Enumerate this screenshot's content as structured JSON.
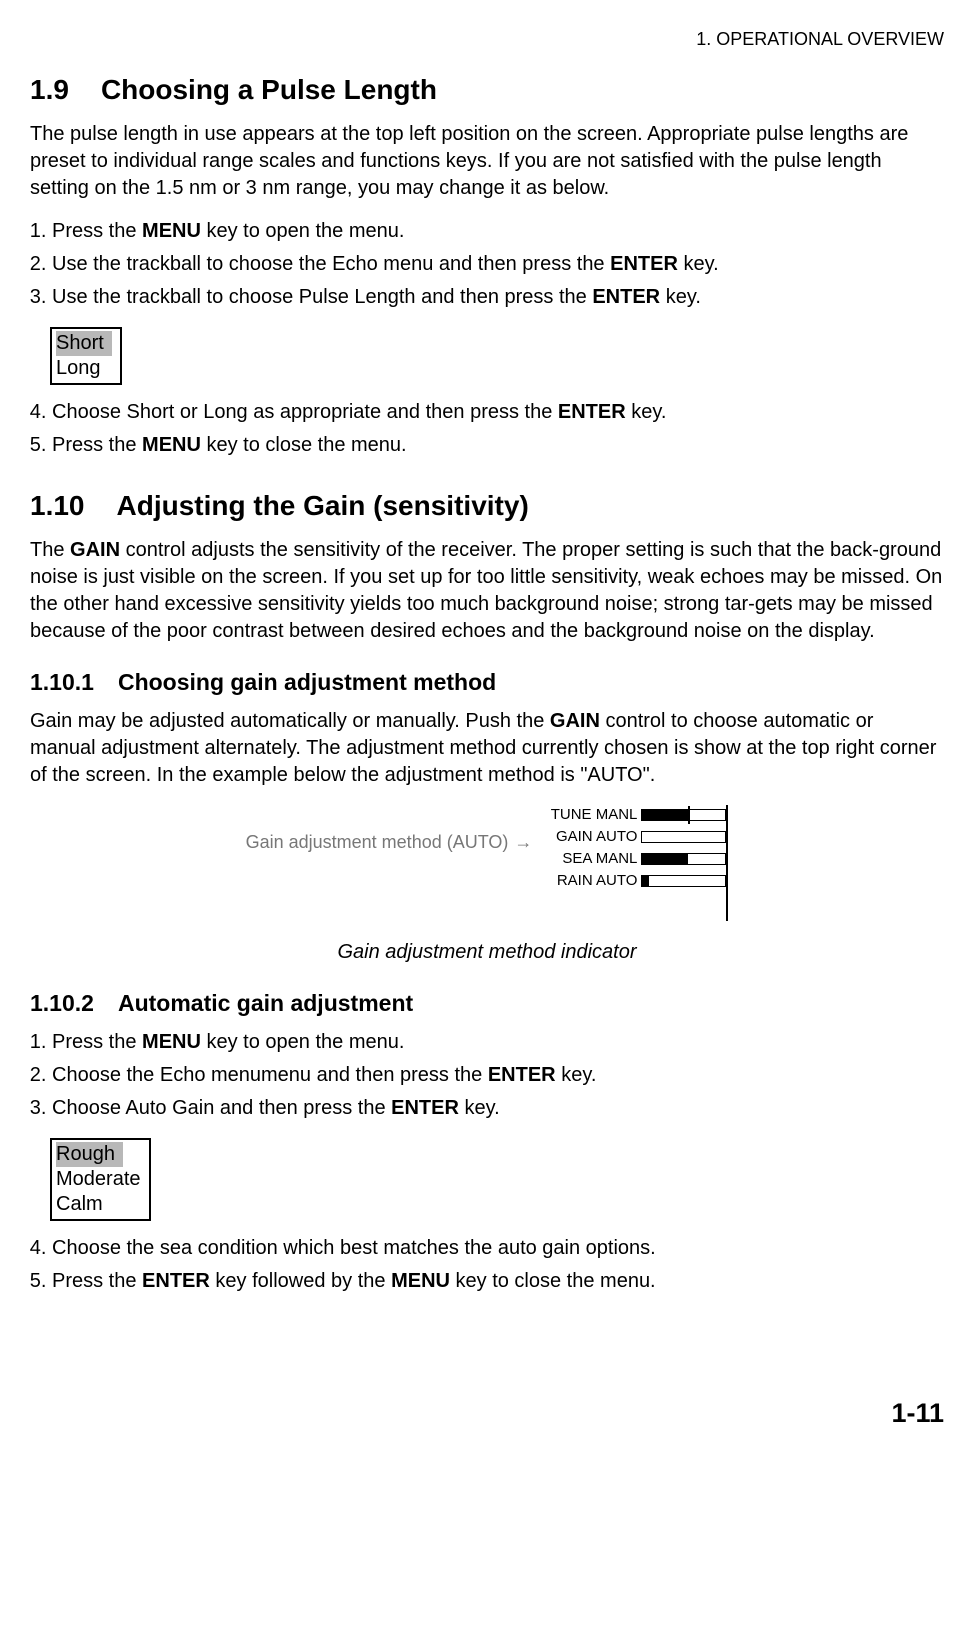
{
  "header": "1. OPERATIONAL OVERVIEW",
  "sec19": {
    "num": "1.9",
    "title": "Choosing a Pulse Length",
    "intro": "The pulse length in use appears at the top left position on the screen. Appropriate pulse lengths are preset to individual range scales and functions keys. If you are not satisfied with the pulse length setting on the 1.5 nm or 3 nm range, you may change it as below.",
    "step1a": "Press the ",
    "step1b": "MENU",
    "step1c": " key to open the menu.",
    "step2a": "Use the trackball to choose the Echo menu and then press the ",
    "step2b": "ENTER",
    "step2c": " key.",
    "step3a": "Use the trackball to choose Pulse Length and then press the ",
    "step3b": "ENTER",
    "step3c": " key.",
    "opt_short": "Short",
    "opt_long": "Long",
    "step4a": "Choose Short or Long as appropriate and then press the ",
    "step4b": "ENTER",
    "step4c": " key.",
    "step5a": "Press the ",
    "step5b": "MENU",
    "step5c": " key to close the menu."
  },
  "sec110": {
    "num": "1.10",
    "title": "Adjusting the Gain (sensitivity)",
    "intro_a": "The ",
    "intro_b": "GAIN",
    "intro_c": " control adjusts the sensitivity of the receiver. The proper setting is such that the back-ground noise is just visible on the screen. If you set up for too little sensitivity, weak echoes may be missed. On the other hand excessive sensitivity yields too much background noise; strong tar-gets may be missed because of the poor contrast between desired echoes and the background noise on the display."
  },
  "sec1101": {
    "num": "1.10.1",
    "title": "Choosing gain adjustment method",
    "body_a": "Gain may be adjusted automatically or manually. Push the ",
    "body_b": "GAIN",
    "body_c": " control to choose automatic or manual adjustment alternately. The adjustment method currently chosen is show at the top right corner of the screen. In the example below the adjustment method is \"AUTO\".",
    "pointer": "Gain adjustment method (AUTO)",
    "tune": "TUNE MANL",
    "gain": "GAIN AUTO",
    "sea": "SEA  MANL",
    "rain": "RAIN AUTO",
    "caption": "Gain adjustment method indicator"
  },
  "sec1102": {
    "num": "1.10.2",
    "title": "Automatic gain adjustment",
    "step1a": "Press the ",
    "step1b": "MENU",
    "step1c": " key to open the menu.",
    "step2a": "Choose the Echo menumenu and then press the ",
    "step2b": "ENTER",
    "step2c": " key.",
    "step3a": "Choose Auto Gain and then press the ",
    "step3b": "ENTER",
    "step3c": " key.",
    "opt_rough": "Rough",
    "opt_moderate": "Moderate",
    "opt_calm": "Calm",
    "step4": "Choose the sea condition which best matches the auto gain options.",
    "step5a": "Press the ",
    "step5b": "ENTER",
    "step5c": " key followed by the ",
    "step5d": "MENU",
    "step5e": " key to close the menu."
  },
  "pagenum": "1-11",
  "chart_data": {
    "type": "bar",
    "title": "Gain adjustment method indicator",
    "categories": [
      "TUNE MANL",
      "GAIN AUTO",
      "SEA MANL",
      "RAIN AUTO"
    ],
    "values": [
      55,
      0,
      55,
      8
    ],
    "xlabel": "",
    "ylabel": "",
    "ylim": [
      0,
      100
    ],
    "note": "Tune bar shows a center tick marker; values are approximate fill percentages of horizontal bars."
  }
}
